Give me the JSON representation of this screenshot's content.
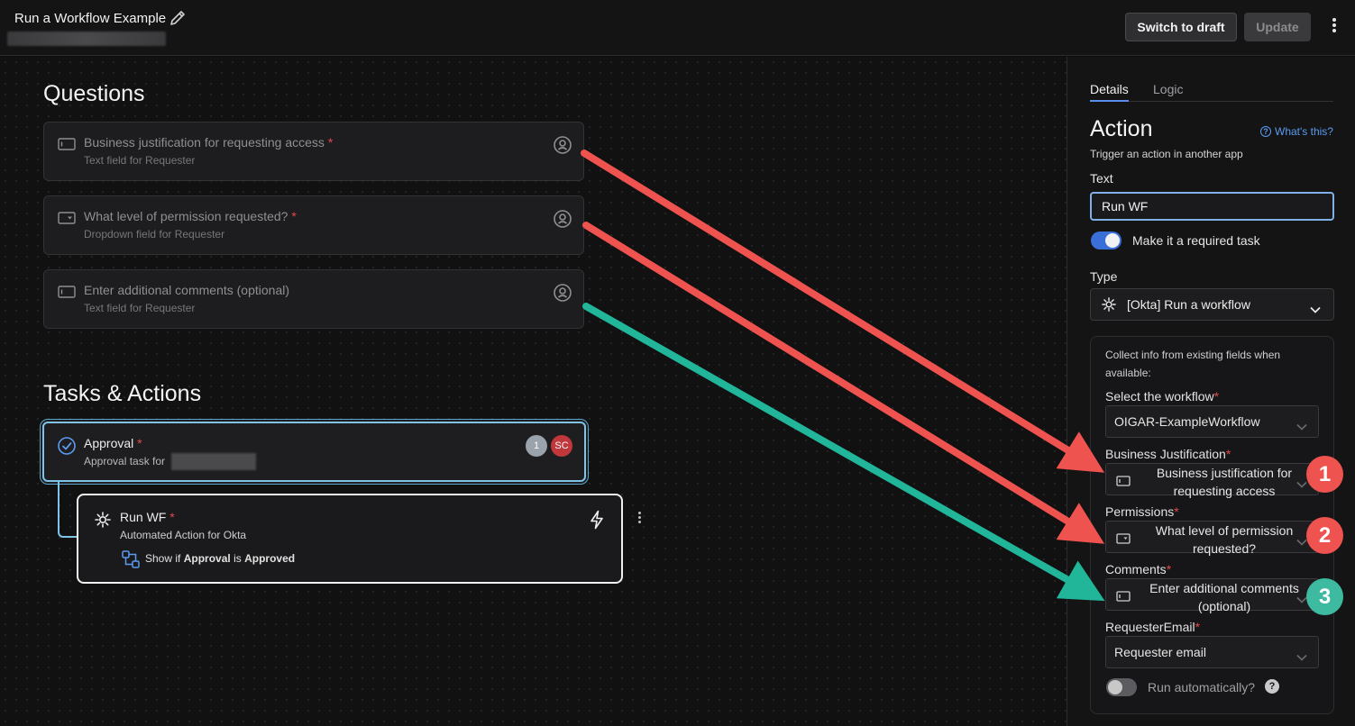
{
  "header": {
    "title": "Run a Workflow Example",
    "switch_to_draft": "Switch to draft",
    "update": "Update"
  },
  "questions": {
    "heading": "Questions",
    "items": [
      {
        "title": "Business justification for requesting access",
        "required": "*",
        "subtitle": "Text field for Requester",
        "icon": "text-field-icon"
      },
      {
        "title": "What level of permission requested?",
        "required": "*",
        "subtitle": "Dropdown field for Requester",
        "icon": "dropdown-field-icon"
      },
      {
        "title": "Enter additional comments (optional)",
        "required": "",
        "subtitle": "Text field for Requester",
        "icon": "text-field-icon"
      }
    ]
  },
  "tasks": {
    "heading": "Tasks & Actions",
    "approval": {
      "title": "Approval",
      "required": "*",
      "subtitle": "Approval task for",
      "badges": [
        "1",
        "SC"
      ]
    },
    "run_wf": {
      "title": "Run WF",
      "required": "*",
      "subtitle": "Automated Action for Okta",
      "condition_prefix": "Show if",
      "condition_field": "Approval",
      "condition_op": "is",
      "condition_value": "Approved"
    }
  },
  "panel": {
    "tabs": [
      "Details",
      "Logic"
    ],
    "heading": "Action",
    "whats_this": "What's this?",
    "description": "Trigger an action in another app",
    "text_label": "Text",
    "text_value": "Run WF",
    "required_toggle_label": "Make it a required task",
    "required_toggle_on": true,
    "type_label": "Type",
    "type_value": "[Okta] Run a workflow",
    "collect_desc": "Collect info from existing fields when available:",
    "fields": [
      {
        "label": "Select the workflow",
        "value": "OIGAR-ExampleWorkflow"
      },
      {
        "label": "Business Justification",
        "value": "Business justification for requesting access",
        "icon": "text-field-icon"
      },
      {
        "label": "Permissions",
        "value": "What level of permission requested?",
        "icon": "dropdown-field-icon"
      },
      {
        "label": "Comments",
        "value": "Enter additional comments (optional)",
        "icon": "text-field-icon"
      },
      {
        "label": "RequesterEmail",
        "value": "Requester email"
      }
    ],
    "run_auto_label": "Run automatically?",
    "run_auto_on": false
  },
  "annotations": {
    "badges": [
      "1",
      "2",
      "3"
    ],
    "colors": {
      "red": "#ef5350",
      "teal": "#21b69a"
    }
  },
  "colors": {
    "accent_blue": "#3a6fd8",
    "required_red": "#e5484d",
    "selection_outline": "#7fc4e8"
  }
}
